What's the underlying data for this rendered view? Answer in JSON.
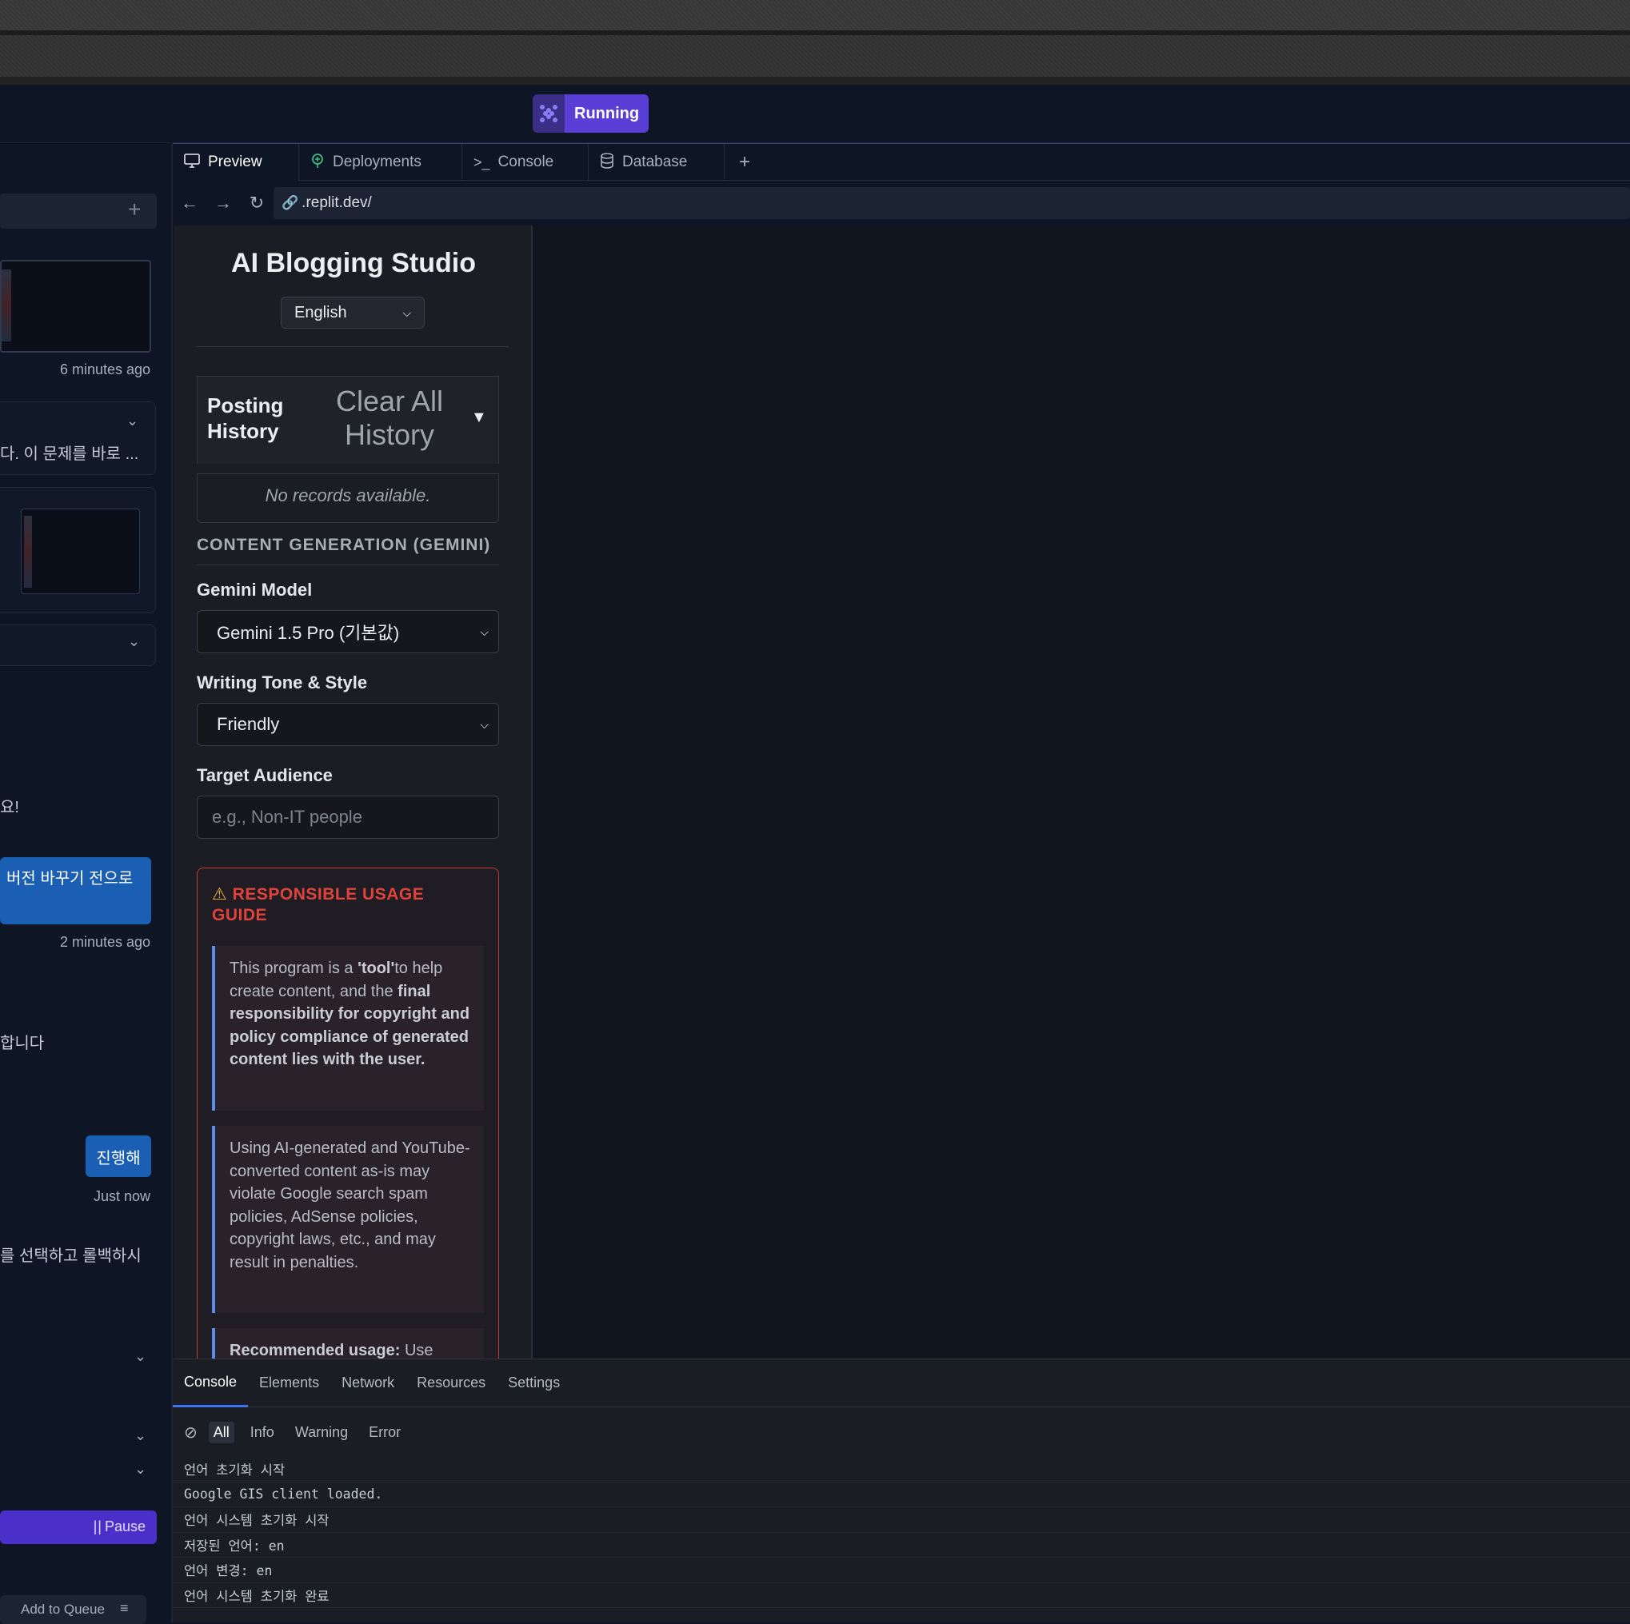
{
  "top": {
    "status_label": "Running"
  },
  "chat": {
    "time1": "6 minutes ago",
    "snippet1": "다. 이 문제를 바로 ...",
    "line_a": "요!",
    "bubble1": "버전 바꾸기 전으로",
    "time2": "2 minutes ago",
    "line_b": "합니다",
    "bubble2": "진행해",
    "time3": "Just now",
    "line_c": "를 선택하고 롤백하시",
    "pause_label": "Pause",
    "queue_label": "Add to Queue"
  },
  "tabs": [
    {
      "label": "Preview",
      "icon": "monitor-icon"
    },
    {
      "label": "Deployments",
      "icon": "deploy-icon"
    },
    {
      "label": "Console",
      "icon": "terminal-icon"
    },
    {
      "label": "Database",
      "icon": "database-icon"
    }
  ],
  "urlbar": {
    "url": ".replit.dev/"
  },
  "app": {
    "title": "AI Blogging Studio",
    "language": "English",
    "history_title": "Posting History",
    "clear_history": "Clear All History",
    "no_records": "No records available.",
    "section_title": "CONTENT GENERATION (GEMINI)",
    "model_label": "Gemini Model",
    "model_value": "Gemini 1.5 Pro (기본값)",
    "tone_label": "Writing Tone & Style",
    "tone_value": "Friendly",
    "audience_label": "Target Audience",
    "audience_placeholder": "e.g., Non-IT people",
    "guide_title": "RESPONSIBLE USAGE GUIDE",
    "guide_p1_a": "This program is a ",
    "guide_p1_b": "'tool'",
    "guide_p1_c": "to help create content, and the ",
    "guide_p1_d": "final responsibility for copyright and policy compliance of generated content lies with the user.",
    "guide_p2": "Using AI-generated and YouTube-converted content as-is may violate Google search spam policies, AdSense policies, copyright laws, etc., and may result in penalties.",
    "guide_p3_a": "Recommended usage:",
    "guide_p3_b": " Use"
  },
  "devtools": {
    "tabs": [
      "Console",
      "Elements",
      "Network",
      "Resources",
      "Settings"
    ],
    "filters": [
      "All",
      "Info",
      "Warning",
      "Error"
    ],
    "lines": [
      "언어 초기화 시작",
      "Google GIS client loaded.",
      "언어 시스템 초기화 시작",
      "저장된 언어: en",
      "언어 변경: en",
      "언어 시스템 초기화 완료"
    ]
  }
}
